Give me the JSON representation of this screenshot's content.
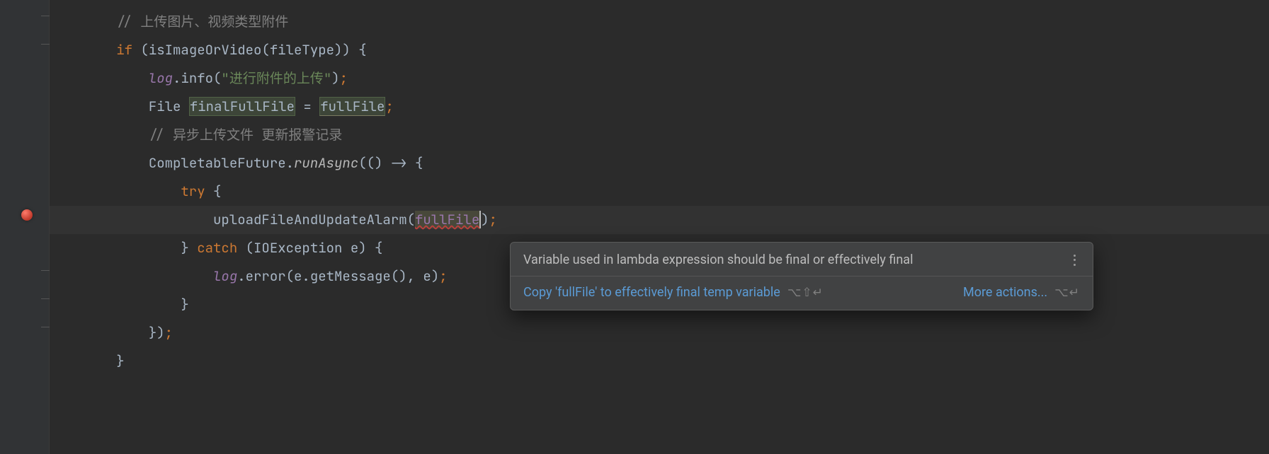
{
  "code": {
    "l1_comment": "// 上传图片、视频类型附件",
    "l2_if": "if",
    "l2_cond": " (isImageOrVideo(fileType)) {",
    "l3_log": "log",
    "l3_info": ".info(",
    "l3_str": "\"进行附件的上传\"",
    "l3_end": ")",
    "l3_semi": ";",
    "l4_type": "File ",
    "l4_var": "finalFullFile",
    "l4_eq": " = ",
    "l4_ref": "fullFile",
    "l4_semi": ";",
    "l5_comment": "// 异步上传文件 更新报警记录",
    "l6_class": "CompletableFuture.",
    "l6_method": "runAsync",
    "l6_tail": "(() -> {",
    "l7_try": "try",
    "l7_brace": " {",
    "l8_call": "uploadFileAndUpdateAlarm(",
    "l8_arg": "fullFile",
    "l8_close": ")",
    "l8_semi": ";",
    "l9_cbrace": "} ",
    "l9_catch": "catch",
    "l9_decl": " (IOException e) {",
    "l10_log": "log",
    "l10_tail": ".error(e.getMessage(), e)",
    "l10_semi": ";",
    "l11": "}",
    "l12": "})",
    "l12_semi": ";",
    "l13": "}"
  },
  "popup": {
    "message": "Variable used in lambda expression should be final or effectively final",
    "action1": "Copy 'fullFile' to effectively final temp variable",
    "shortcut1": "⌥⇧↵",
    "action2": "More actions...",
    "shortcut2": "⌥↵"
  }
}
